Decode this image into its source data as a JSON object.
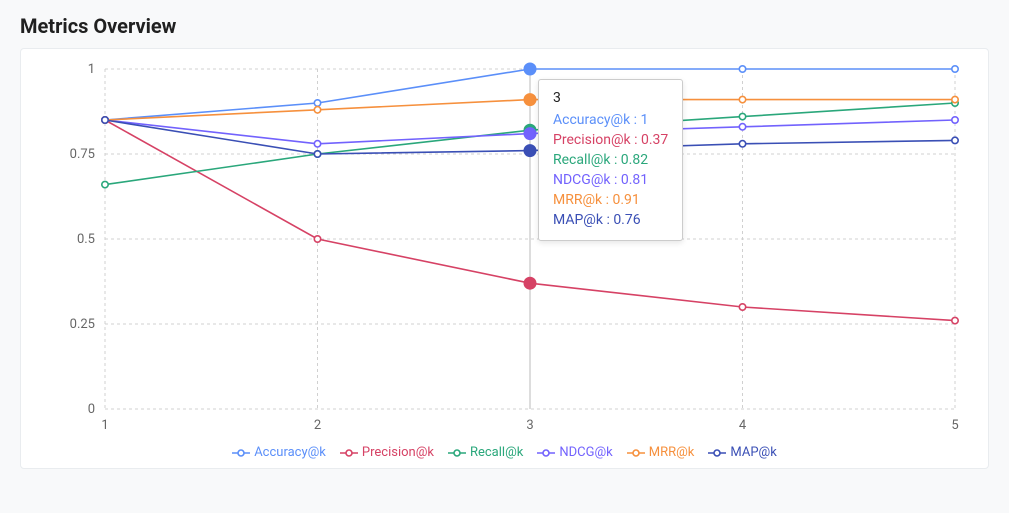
{
  "title": "Metrics Overview",
  "chart_data": {
    "type": "line",
    "xlabel": "",
    "ylabel": "",
    "xlim": [
      1,
      5
    ],
    "ylim": [
      0,
      1
    ],
    "x_ticks": [
      1,
      2,
      3,
      4,
      5
    ],
    "y_ticks": [
      0,
      0.25,
      0.5,
      0.75,
      1
    ],
    "categories": [
      1,
      2,
      3,
      4,
      5
    ],
    "series": [
      {
        "name": "Accuracy@k",
        "color": "#5b8ff9",
        "values": [
          0.85,
          0.9,
          1.0,
          1.0,
          1.0
        ]
      },
      {
        "name": "Precision@k",
        "color": "#d64265",
        "values": [
          0.85,
          0.5,
          0.37,
          0.3,
          0.26
        ]
      },
      {
        "name": "Recall@k",
        "color": "#2aa77b",
        "values": [
          0.66,
          0.75,
          0.82,
          0.86,
          0.9
        ]
      },
      {
        "name": "NDCG@k",
        "color": "#7262fd",
        "values": [
          0.85,
          0.78,
          0.81,
          0.83,
          0.85
        ]
      },
      {
        "name": "MRR@k",
        "color": "#f6903d",
        "values": [
          0.85,
          0.88,
          0.91,
          0.91,
          0.91
        ]
      },
      {
        "name": "MAP@k",
        "color": "#3a4fb5",
        "values": [
          0.85,
          0.75,
          0.76,
          0.78,
          0.79
        ]
      }
    ],
    "tooltip": {
      "x": 3,
      "rows": [
        {
          "series": "Accuracy@k",
          "value": 1
        },
        {
          "series": "Precision@k",
          "value": 0.37
        },
        {
          "series": "Recall@k",
          "value": 0.82
        },
        {
          "series": "NDCG@k",
          "value": 0.81
        },
        {
          "series": "MRR@k",
          "value": 0.91
        },
        {
          "series": "MAP@k",
          "value": 0.76
        }
      ]
    },
    "grid": true,
    "legend_position": "bottom"
  }
}
